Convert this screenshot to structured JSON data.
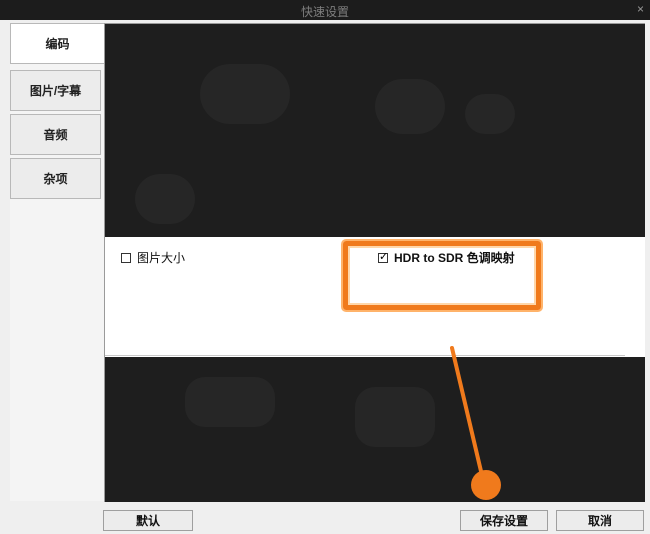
{
  "window": {
    "title": "快速设置",
    "close_glyph": "×"
  },
  "sidebar": {
    "tabs": [
      {
        "label": "编码",
        "active": true
      },
      {
        "label": "图片/字幕",
        "active": false
      },
      {
        "label": "音频",
        "active": false
      },
      {
        "label": "杂项",
        "active": false
      }
    ]
  },
  "options": {
    "image_size": {
      "label": "图片大小",
      "checked": false
    },
    "hdr_to_sdr": {
      "label": "HDR to SDR 色调映射",
      "checked": true
    }
  },
  "buttons": {
    "default": "默认",
    "save": "保存设置",
    "cancel": "取消"
  },
  "annotation": {
    "accent_color": "#f07a1c"
  }
}
